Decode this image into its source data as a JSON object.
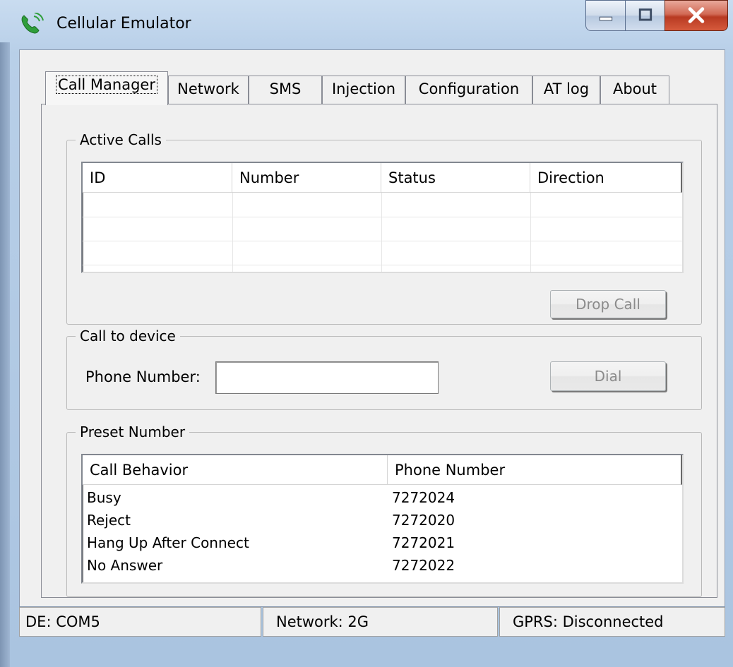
{
  "window": {
    "title": "Cellular Emulator"
  },
  "tabs": [
    {
      "label": "Call Manager",
      "active": true
    },
    {
      "label": "Network",
      "active": false
    },
    {
      "label": "SMS",
      "active": false
    },
    {
      "label": "Injection",
      "active": false
    },
    {
      "label": "Configuration",
      "active": false
    },
    {
      "label": "AT log",
      "active": false
    },
    {
      "label": "About",
      "active": false
    }
  ],
  "active_calls": {
    "title": "Active Calls",
    "columns": [
      "ID",
      "Number",
      "Status",
      "Direction"
    ],
    "rows": [],
    "drop_button": "Drop Call"
  },
  "call_to_device": {
    "title": "Call to device",
    "phone_label": "Phone Number:",
    "phone_value": "",
    "dial_button": "Dial"
  },
  "preset": {
    "title": "Preset Number",
    "columns": [
      "Call Behavior",
      "Phone Number"
    ],
    "rows": [
      {
        "behavior": "Busy",
        "number": "7272024"
      },
      {
        "behavior": "Reject",
        "number": "7272020"
      },
      {
        "behavior": "Hang Up After Connect",
        "number": "7272021"
      },
      {
        "behavior": "No Answer",
        "number": "7272022"
      }
    ]
  },
  "status": {
    "port": "DE: COM5",
    "network": "Network: 2G",
    "gprs": "GPRS: Disconnected"
  },
  "icons": {
    "app": "phone-icon",
    "minimize": "minimize-icon",
    "maximize": "maximize-icon",
    "close": "close-icon"
  }
}
